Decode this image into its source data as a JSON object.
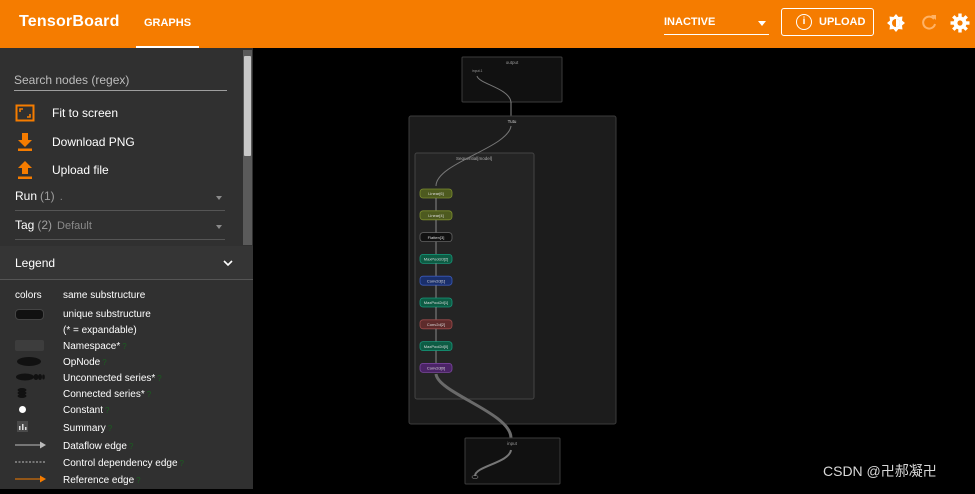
{
  "header": {
    "brand": "TensorBoard",
    "tab_graphs": "GRAPHS",
    "run_status": "INACTIVE",
    "upload_label": "UPLOAD",
    "upload_icon_glyph": "i",
    "bg_color": "#f57c00"
  },
  "sidebar": {
    "search_placeholder": "Search nodes (regex)",
    "fit_label": "Fit to screen",
    "download_label": "Download PNG",
    "upload_label": "Upload file",
    "run_label": "Run",
    "run_count": "(1)",
    "run_value": ".",
    "tag_label": "Tag",
    "tag_count": "(2)",
    "tag_value": "Default",
    "icon_color": "#f57c00"
  },
  "legend": {
    "title": "Legend",
    "colors_label": "colors",
    "same_sub": "same substructure",
    "unique_sub": "unique substructure",
    "expandable": "(* = expandable)",
    "namespace": "Namespace*",
    "namespace_sup": "?",
    "opnode": "OpNode",
    "opnode_sup": "?",
    "unconnected": "Unconnected series*",
    "unconnected_sup": "?",
    "connected": "Connected series*",
    "connected_sup": "?",
    "constant": "Constant",
    "constant_sup": "?",
    "summary": "Summary",
    "summary_sup": "?",
    "dataflow": "Dataflow edge",
    "dataflow_sup": "?",
    "control": "Control dependency edge",
    "control_sup": "?",
    "reference": "Reference edge",
    "reference_sup": "?"
  },
  "graph": {
    "output_box": "output",
    "output_inner": "input.1",
    "tutu_box": "Tutu",
    "sequential_box": "Sequential[model]",
    "input_box": "input",
    "nodes": [
      {
        "label": "Linear[6]",
        "color": "#4d5a1f",
        "border": "#7b8c2e"
      },
      {
        "label": "Linear[4]",
        "color": "#4d5a1f",
        "border": "#7b8c2e"
      },
      {
        "label": "Flatten[3]",
        "color": "#111111",
        "border": "#666666"
      },
      {
        "label": "MaxPool2d[2]",
        "color": "#0d5c44",
        "border": "#17977a"
      },
      {
        "label": "Conv2d[1]",
        "color": "#1a2f6b",
        "border": "#3a59b8"
      },
      {
        "label": "MaxPool2d[1]",
        "color": "#0d5c44",
        "border": "#17977a"
      },
      {
        "label": "Conv2d[2]",
        "color": "#5e2b2b",
        "border": "#9a4a4a"
      },
      {
        "label": "MaxPool2d[0]",
        "color": "#0d5c44",
        "border": "#17977a"
      },
      {
        "label": "Conv2d[0]",
        "color": "#4b2466",
        "border": "#7e47a3"
      }
    ]
  },
  "watermark": "CSDN @卍郝凝卍"
}
